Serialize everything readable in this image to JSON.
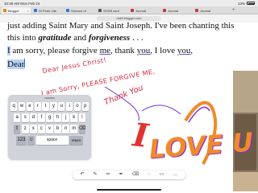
{
  "status_bar": {
    "time": "10:45 AM",
    "date": "Mon Feb 24",
    "battery": "13%",
    "battery_icon": "battery-icon"
  },
  "tabs": [
    {
      "label": "Blogger",
      "color": "#f57c00",
      "active": true
    },
    {
      "label": "St Peter Life",
      "color": "#3a6fd8",
      "active": false
    },
    {
      "label": "Science of",
      "color": "#3a6fd8",
      "active": false
    },
    {
      "label": "SCRB sent",
      "color": "#555555",
      "active": false
    },
    {
      "label": "Journal",
      "color": "#c23b3b",
      "active": false
    },
    {
      "label": "Journal",
      "color": "#c23b3b",
      "active": false
    },
    {
      "label": "Journal",
      "color": "#c23b3b",
      "active": false
    }
  ],
  "address_bar": {
    "url": "draft.blogger.com"
  },
  "document": {
    "line1": "just adding Saint Mary and Saint Joseph. I've been chanting this",
    "line2_pre": "this into ",
    "gratitude": "gratitude",
    "and": " and ",
    "forgiveness": "forgiveness",
    "ellipsis": " . . .",
    "line3_i": "I",
    "line3_mid": " am sorry, please forgive ",
    "me": "me",
    "comma1": ", thank ",
    "you1": "you",
    "mid2": ", I love ",
    "you2": "you",
    "comma2": ",",
    "dear": "Dear"
  },
  "handwriting": {
    "line1": "Dear Jesus Christ!",
    "line2": "I am Sorry, PLEASE FORGIVE ME,",
    "line3": "Thank You",
    "big_i": "I",
    "love": "LOVE U",
    "colors": {
      "red": "#d7263d",
      "orange": "#f08a2b",
      "purple": "#8a2bd7"
    }
  },
  "keyboard": {
    "row1": [
      "q",
      "w",
      "e",
      "r",
      "t",
      "y",
      "u",
      "i",
      "o",
      "p"
    ],
    "row2": [
      "a",
      "s",
      "d",
      "f",
      "g",
      "h",
      "j",
      "k",
      "l"
    ],
    "row3": [
      "⇧",
      "z",
      "x",
      "c",
      "v",
      "b",
      "n",
      "m",
      "⌫"
    ],
    "row4_left": "123",
    "row4_emoji": "☺",
    "space": "space",
    "return": "return"
  },
  "toolbar": {
    "icons": [
      "undo-icon",
      "marker-icon",
      "pencil-icon",
      "pen-icon",
      "eraser-icon",
      "lasso-icon",
      "ruler-icon",
      "ellipsis-icon"
    ],
    "glyphs": [
      "↶",
      "✎",
      "✏",
      "✒",
      "⌫",
      "◌",
      "▭",
      "…"
    ]
  }
}
